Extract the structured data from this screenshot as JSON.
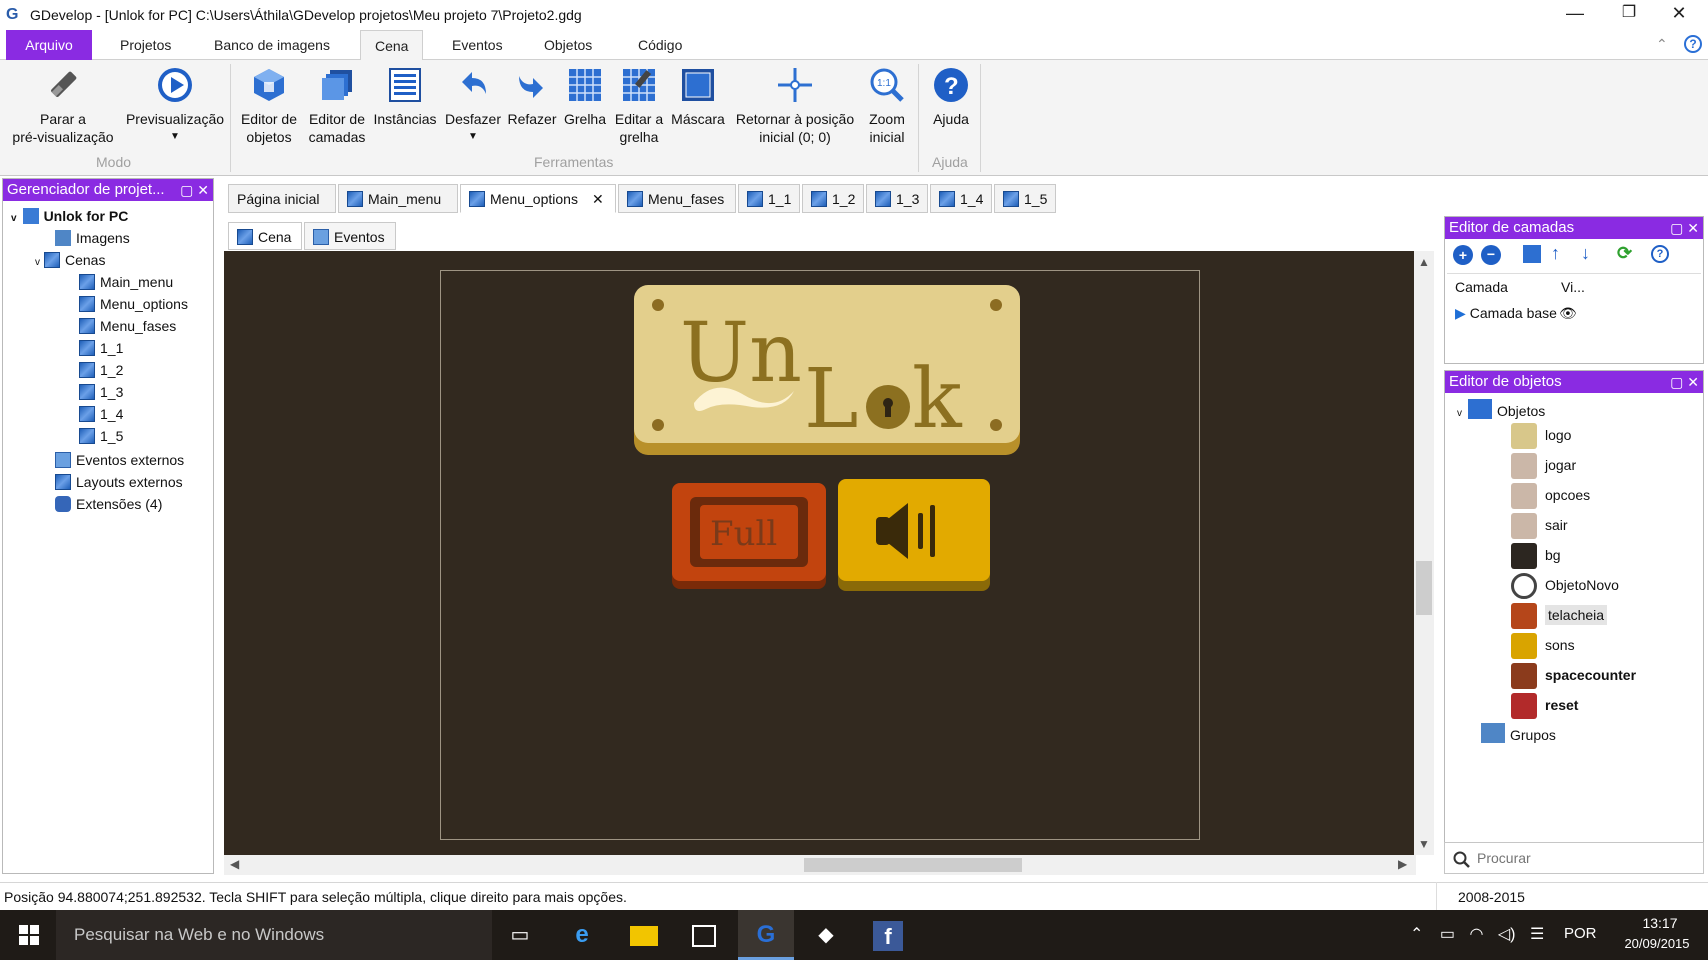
{
  "window": {
    "app_icon": "G",
    "title": "GDevelop - [Unlok for PC] C:\\Users\\Áthila\\GDevelop projetos\\Meu projeto 7\\Projeto2.gdg",
    "minimize": "—",
    "maximize": "❐",
    "close": "✕"
  },
  "ribbon_tabs": [
    "Arquivo",
    "Projetos",
    "Banco de imagens",
    "Cena",
    "Eventos",
    "Objetos",
    "Código"
  ],
  "ribbon_right": {
    "collapse": "⌃",
    "help": "?"
  },
  "ribbon": {
    "mode_group": "Modo",
    "tools_group": "Ferramentas",
    "help_group": "Ajuda",
    "stop_preview": "Parar a\npré-visualização",
    "preview": "Previsualização",
    "objects_editor": "Editor de\nobjetos",
    "layers_editor": "Editor de\ncamadas",
    "instances": "Instâncias",
    "undo": "Desfazer",
    "redo": "Refazer",
    "grid": "Grelha",
    "edit_grid": "Editar a\ngrelha",
    "mask": "Máscara",
    "return_origin": "Retornar à posição\ninicial (0; 0)",
    "zoom": "Zoom\ninicial",
    "help": "Ajuda"
  },
  "project_panel": {
    "title": "Gerenciador de projet...",
    "root": "Unlok for PC",
    "images": "Imagens",
    "scenes": "Cenas",
    "scene_list": [
      "Main_menu",
      "Menu_options",
      "Menu_fases",
      "1_1",
      "1_2",
      "1_3",
      "1_4",
      "1_5"
    ],
    "external_events": "Eventos externos",
    "external_layouts": "Layouts externos",
    "extensions": "Extensões (4)"
  },
  "doc_tabs": [
    "Página inicial",
    "Main_menu",
    "Menu_options",
    "Menu_fases",
    "1_1",
    "1_2",
    "1_3",
    "1_4",
    "1_5"
  ],
  "sub_tabs": [
    "Cena",
    "Eventos"
  ],
  "scene": {
    "logo_text_1": "Un",
    "logo_text_2": "L",
    "logo_text_3": "k",
    "full_button": "Full"
  },
  "layers_panel": {
    "title": "Editor de camadas",
    "col_layer": "Camada",
    "col_visible": "Vi...",
    "base_layer": "Camada base"
  },
  "objects_panel": {
    "title": "Editor de objetos",
    "root": "Objetos",
    "items": [
      {
        "name": "logo",
        "color": "#d8c78a",
        "bold": false
      },
      {
        "name": "jogar",
        "color": "#cbb7a8",
        "bold": false
      },
      {
        "name": "opcoes",
        "color": "#cbb7a8",
        "bold": false
      },
      {
        "name": "sair",
        "color": "#cbb7a8",
        "bold": false
      },
      {
        "name": "bg",
        "color": "#2c2620",
        "bold": false
      },
      {
        "name": "ObjetoNovo",
        "color": "#ffffff",
        "bold": false
      },
      {
        "name": "telacheia",
        "color": "#b5461a",
        "bold": false
      },
      {
        "name": "sons",
        "color": "#d9a400",
        "bold": false
      },
      {
        "name": "spacecounter",
        "color": "#8b3b1c",
        "bold": true
      },
      {
        "name": "reset",
        "color": "#b22a2a",
        "bold": true
      }
    ],
    "groups": "Grupos"
  },
  "search": {
    "placeholder": "Procurar"
  },
  "status": {
    "message": "Posição 94.880074;251.892532. Tecla SHIFT para seleção múltipla, clique direito para mais opções.",
    "years": "2008-2015"
  },
  "taskbar": {
    "search_placeholder": "Pesquisar na Web e no Windows",
    "language": "POR",
    "time": "13:17",
    "date": "20/09/2015"
  }
}
